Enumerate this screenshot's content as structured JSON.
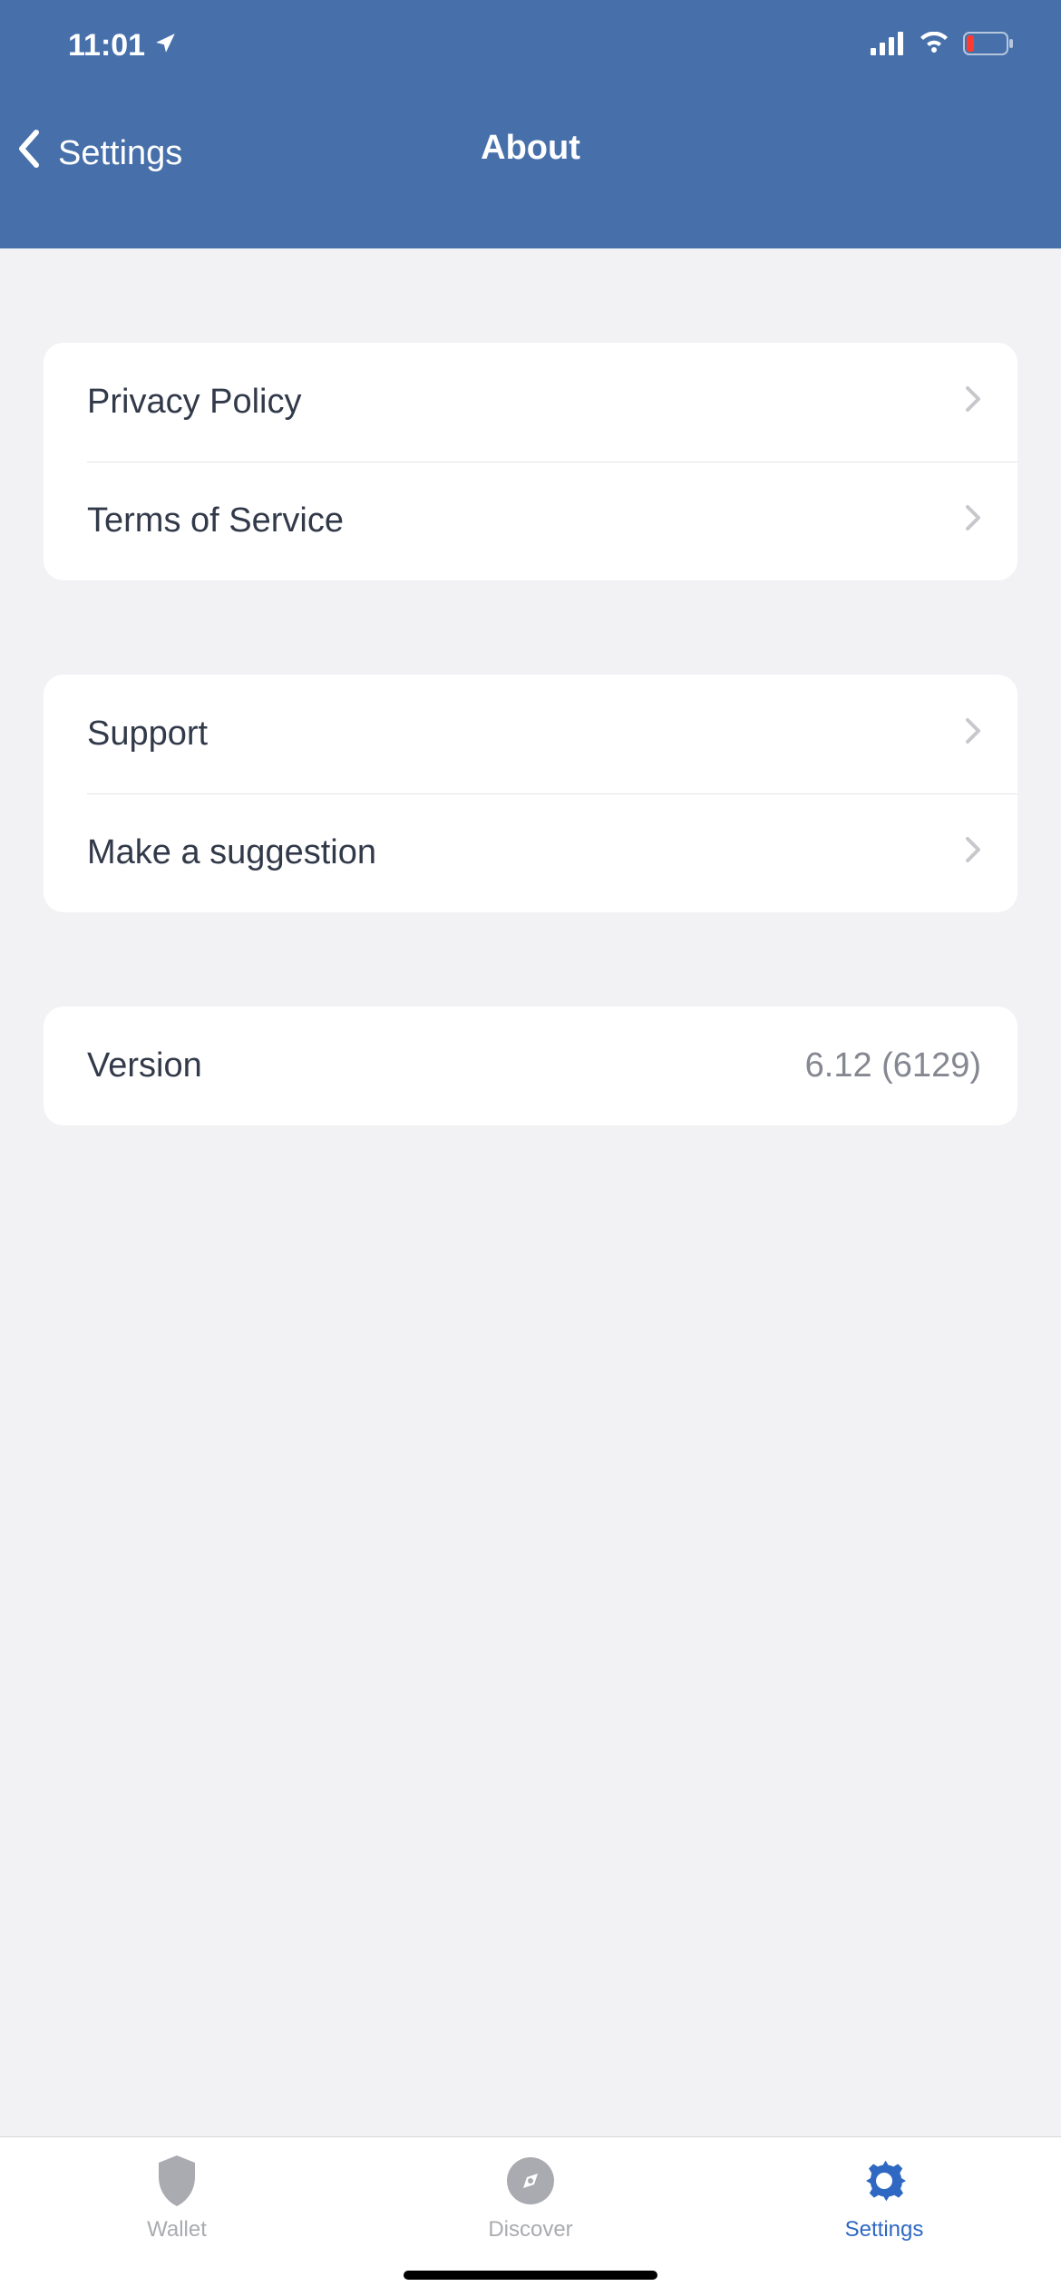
{
  "status": {
    "time": "11:01"
  },
  "nav": {
    "back_label": "Settings",
    "title": "About"
  },
  "sections": {
    "legal": {
      "privacy": "Privacy Policy",
      "terms": "Terms of Service"
    },
    "help": {
      "support": "Support",
      "suggestion": "Make a suggestion"
    },
    "info": {
      "version_label": "Version",
      "version_value": "6.12 (6129)"
    }
  },
  "tabs": {
    "wallet": "Wallet",
    "discover": "Discover",
    "settings": "Settings"
  }
}
